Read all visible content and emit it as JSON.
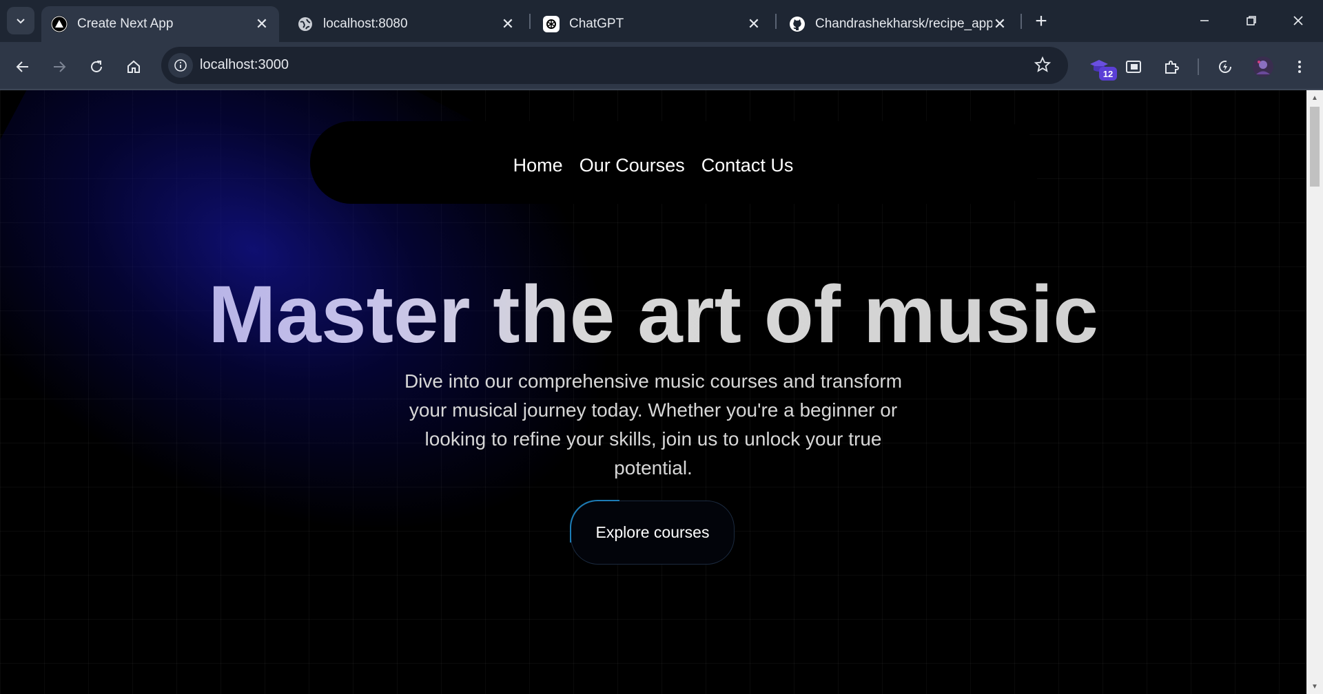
{
  "browser": {
    "tabs": [
      {
        "title": "Create Next App",
        "active": true,
        "favicon": "nextjs-icon"
      },
      {
        "title": "localhost:8080",
        "active": false,
        "favicon": "globe-icon"
      },
      {
        "title": "ChatGPT",
        "active": false,
        "favicon": "chatgpt-icon"
      },
      {
        "title": "Chandrashekharsk/recipe_app",
        "active": false,
        "favicon": "github-icon"
      }
    ],
    "close_glyph": "✕",
    "new_tab_glyph": "+",
    "address": "localhost:3000",
    "extension_badge": "12"
  },
  "page": {
    "nav": {
      "home": "Home",
      "courses": "Our Courses",
      "contact": "Contact Us"
    },
    "hero": {
      "title": "Master the art of music",
      "subtitle": "Dive into our comprehensive music courses and transform your musical journey today. Whether you're a beginner or looking to refine your skills, join us to unlock your true potential.",
      "cta_label": "Explore courses"
    }
  },
  "colors": {
    "tabbar": "#1e2633",
    "toolbar": "#2e3747",
    "page_bg": "#000000",
    "glow": "#14148c",
    "cta_accent": "#1e88c7"
  }
}
